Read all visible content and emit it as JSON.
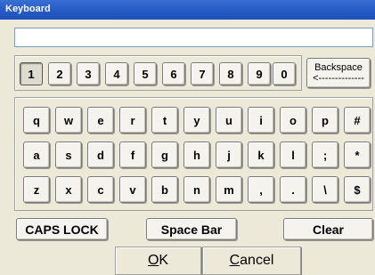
{
  "window": {
    "title": "Keyboard"
  },
  "input": {
    "value": ""
  },
  "numbers": [
    "1",
    "2",
    "3",
    "4",
    "5",
    "6",
    "7",
    "8",
    "9",
    "0"
  ],
  "backspace": {
    "label": "Backspace",
    "arrow": "<--------------"
  },
  "rows": [
    [
      "q",
      "w",
      "e",
      "r",
      "t",
      "y",
      "u",
      "i",
      "o",
      "p",
      "#"
    ],
    [
      "a",
      "s",
      "d",
      "f",
      "g",
      "h",
      "j",
      "k",
      "l",
      ";",
      "*"
    ],
    [
      "z",
      "x",
      "c",
      "v",
      "b",
      "n",
      "m",
      ",",
      ".",
      "\\",
      "$"
    ]
  ],
  "caps_lock": "CAPS LOCK",
  "space_bar": "Space Bar",
  "clear": "Clear",
  "ok": {
    "prefix": "",
    "accel": "O",
    "rest": "K"
  },
  "cancel": {
    "prefix": "",
    "accel": "C",
    "rest": "ancel"
  },
  "colors": {
    "titlebar": "#2a5fc8",
    "face": "#ece9d8"
  }
}
